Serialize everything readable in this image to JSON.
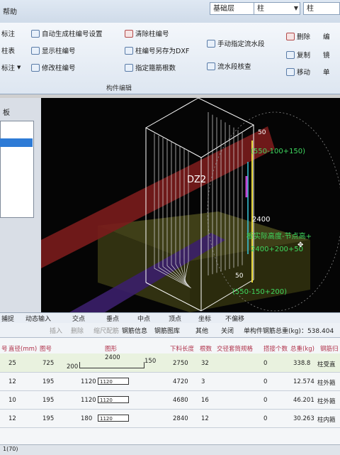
{
  "title": {
    "menu_fragment": "帮助"
  },
  "layer_selector": {
    "floor": "基础层",
    "type1": "柱",
    "type2": "柱"
  },
  "ribbon": {
    "col1": [
      "标注",
      "柱表",
      "标注"
    ],
    "col2": [
      "自动生成柱编号设置",
      "显示柱编号",
      "修改柱编号"
    ],
    "col3": [
      "清除柱编号",
      "柱编号另存为DXF",
      "指定箍筋根数"
    ],
    "col4": [
      "手动指定流水段",
      "流水段核查"
    ],
    "col5": [
      "删除",
      "复制",
      "移动"
    ],
    "col6": [
      "编",
      "镜",
      "单"
    ],
    "group_label": "构件编辑"
  },
  "left_panel": {
    "title": "板"
  },
  "viewport": {
    "column_label": "DZ2",
    "annotations": {
      "top": "50",
      "top_formula": "(550-100+150)",
      "mid_value": "2400",
      "mid_formula": "板实际高度-节点高+",
      "mid_formula2": "2400+200+50",
      "bottom_value": "50",
      "bottom_formula": "(550-150+200)"
    }
  },
  "snap_toolbar": {
    "items": [
      "捕捉",
      "动态输入",
      "交点",
      "垂点",
      "中点",
      "顶点",
      "坐标",
      "不偏移"
    ]
  },
  "rebar_toolbar": {
    "items": [
      "插入",
      "删除",
      "缩尺配筋",
      "钢筋信息",
      "钢筋图库",
      "其他",
      "关闭"
    ],
    "total_label": "单构件钢筋总重(kg)：538.404"
  },
  "table": {
    "headers": [
      "号",
      "直径(mm)",
      "图号",
      "图形",
      "下料长度",
      "根数",
      "交径套筒规格",
      "搭接个数",
      "总重(kg)",
      "钢筋归"
    ],
    "rows": [
      {
        "index": "",
        "diameter": "25",
        "fig": "725",
        "shape_left": "200",
        "shape_mid": "2400",
        "shape_right": "150",
        "length": "2750",
        "count": "32",
        "sleeve": "0",
        "weight": "338.8",
        "category": "柱受直"
      },
      {
        "index": "",
        "diameter": "12",
        "fig": "195",
        "shape_left": "1120",
        "shape_mid": "1120",
        "shape_right": "",
        "length": "4720",
        "count": "3",
        "sleeve": "0",
        "weight": "12.574",
        "category": "柱外箍"
      },
      {
        "index": "",
        "diameter": "10",
        "fig": "195",
        "shape_left": "1120",
        "shape_mid": "1120",
        "shape_right": "",
        "length": "4680",
        "count": "16",
        "sleeve": "0",
        "weight": "46.201",
        "category": "柱外箍"
      },
      {
        "index": "",
        "diameter": "12",
        "fig": "195",
        "shape_left": "180",
        "shape_mid": "1120",
        "shape_right": "",
        "length": "2840",
        "count": "12",
        "sleeve": "0",
        "weight": "30.263",
        "category": "柱内箍"
      }
    ]
  },
  "status": {
    "page": "1(70)"
  },
  "colors": {
    "annot_green": "#3fd85f",
    "wire": "#ffffff",
    "beam_red": "#7a1c1c",
    "slab_olive": "#4a4a1c",
    "ribbon_bg": "#eaf0f7"
  }
}
